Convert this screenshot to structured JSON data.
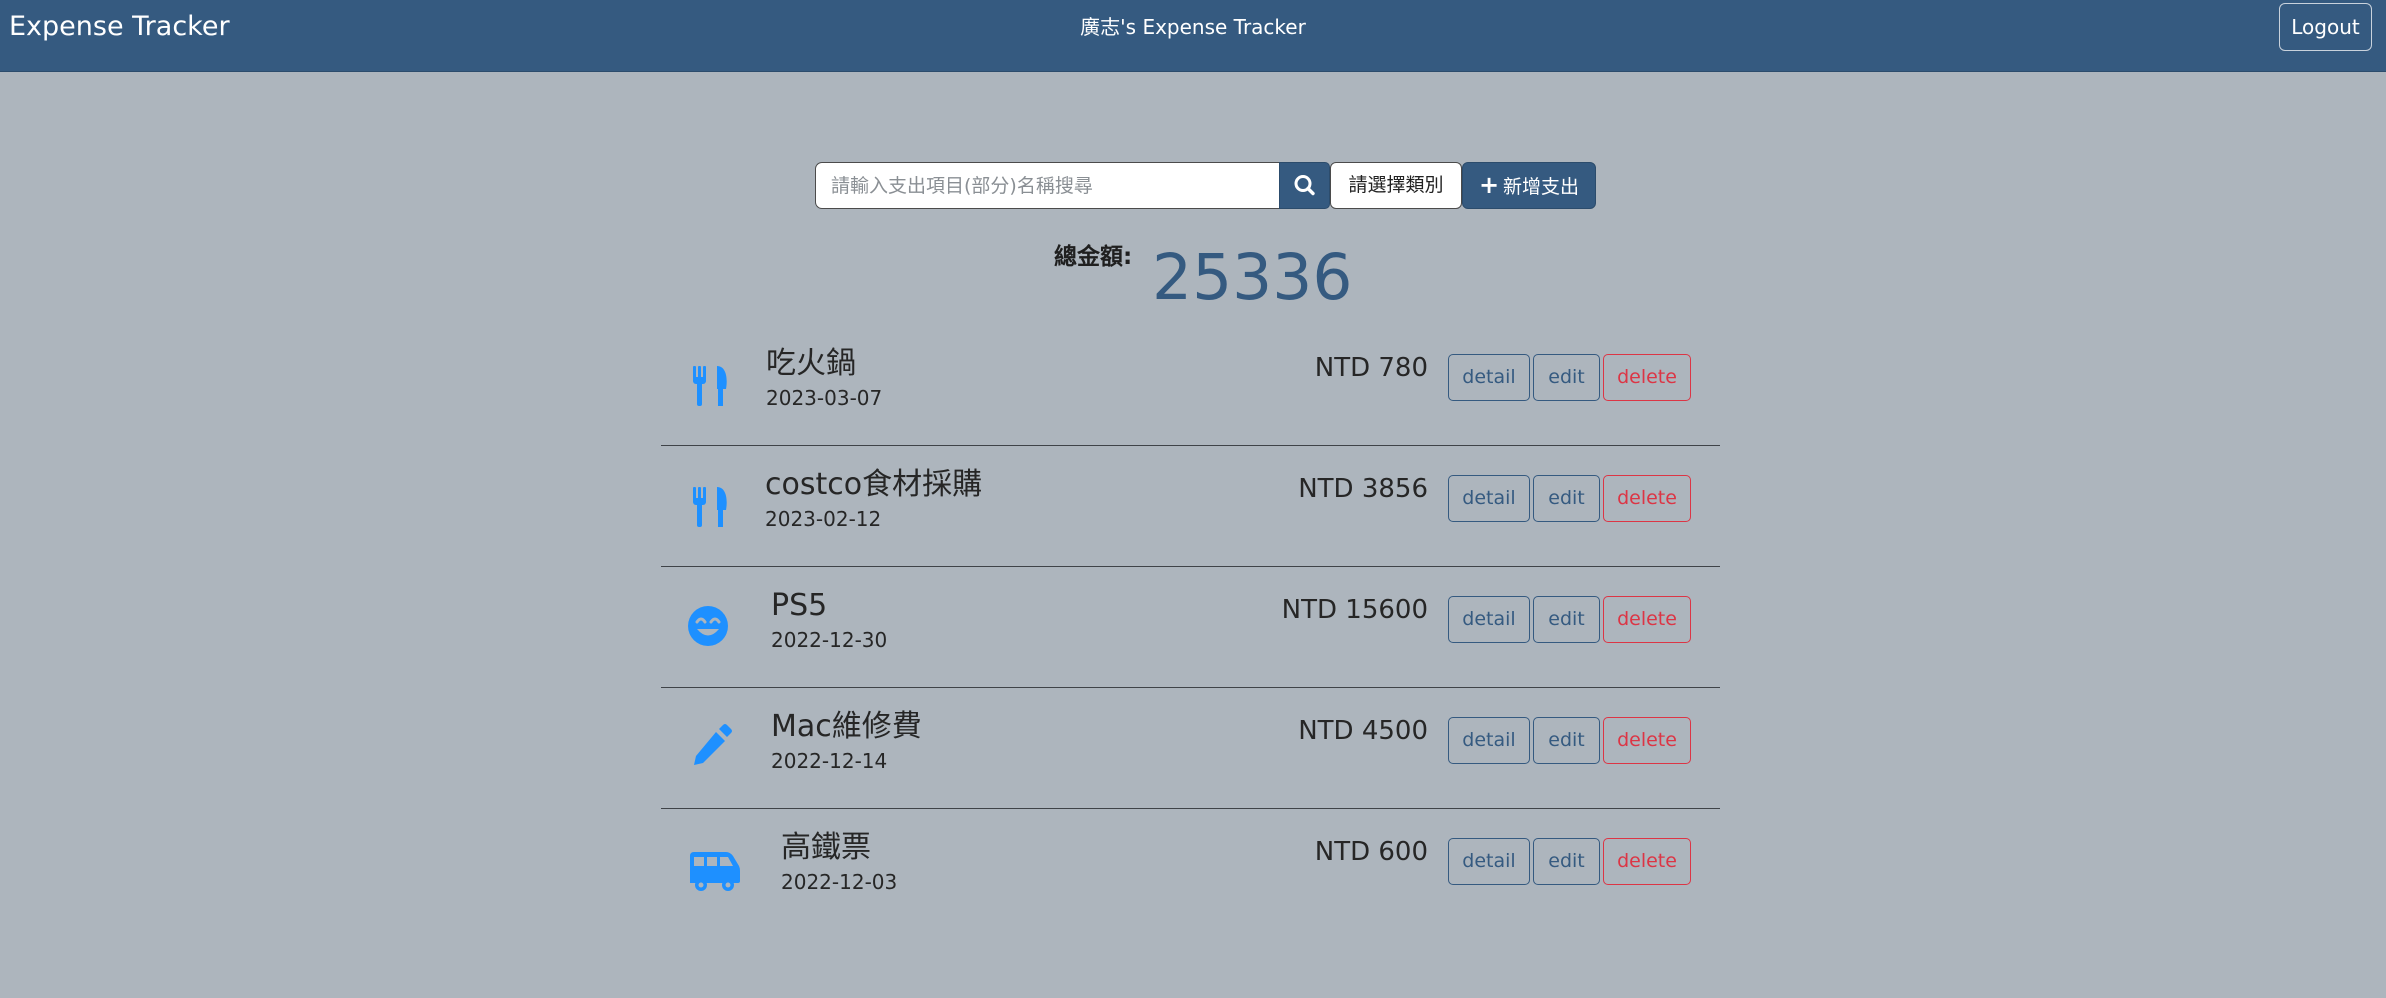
{
  "navbar": {
    "brand": "Expense Tracker",
    "title": "廣志's Expense Tracker",
    "logout_label": "Logout"
  },
  "toolbar": {
    "search_placeholder": "請輸入支出項目(部分)名稱搜尋",
    "search_icon": "search-icon",
    "category_label": "請選擇類別",
    "add_label": "新增支出",
    "add_icon": "plus-icon"
  },
  "total": {
    "label": "總金額:",
    "value": "25336"
  },
  "colors": {
    "navbar": "#355a80",
    "background": "#adb5bd",
    "icon": "#1e90ff",
    "accent": "#355a80",
    "danger": "#dc3545"
  },
  "records": [
    {
      "icon": "utensils-icon",
      "name": "吃火鍋",
      "date": "2023-03-07",
      "amount": "NTD 780",
      "detail": "detail",
      "edit": "edit",
      "delete": "delete"
    },
    {
      "icon": "utensils-icon",
      "name": "costco食材採購",
      "date": "2023-02-12",
      "amount": "NTD 3856",
      "detail": "detail",
      "edit": "edit",
      "delete": "delete"
    },
    {
      "icon": "smile-icon",
      "name": "PS5",
      "date": "2022-12-30",
      "amount": "NTD 15600",
      "detail": "detail",
      "edit": "edit",
      "delete": "delete"
    },
    {
      "icon": "pen-icon",
      "name": "Mac維修費",
      "date": "2022-12-14",
      "amount": "NTD 4500",
      "detail": "detail",
      "edit": "edit",
      "delete": "delete"
    },
    {
      "icon": "shuttle-van-icon",
      "name": "高鐵票",
      "date": "2022-12-03",
      "amount": "NTD 600",
      "detail": "detail",
      "edit": "edit",
      "delete": "delete"
    }
  ]
}
